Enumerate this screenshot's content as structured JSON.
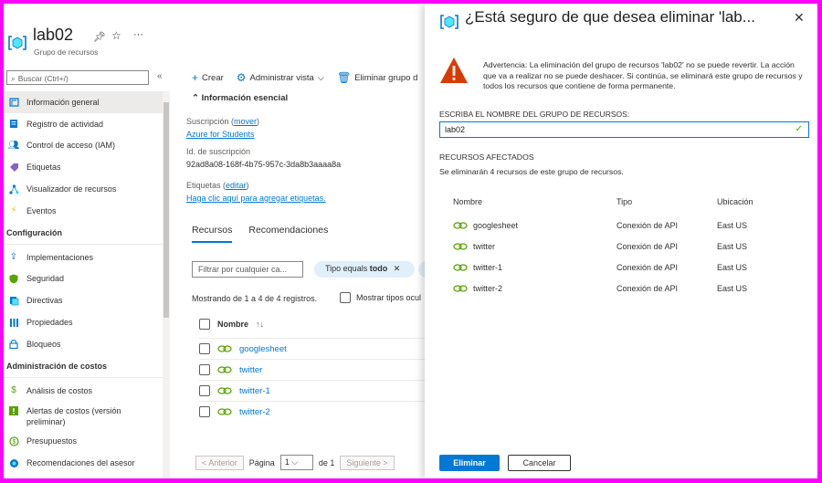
{
  "header": {
    "title": "lab02",
    "subtitle": "Grupo de recursos",
    "more": "···"
  },
  "sidebar": {
    "search_placeholder": "Buscar (Ctrl+/)",
    "collapse": "«",
    "items": [
      {
        "label": "Información general",
        "icon": "overview-icon",
        "active": true
      },
      {
        "label": "Registro de actividad",
        "icon": "activity-log-icon"
      },
      {
        "label": "Control de acceso (IAM)",
        "icon": "iam-icon"
      },
      {
        "label": "Etiquetas",
        "icon": "tag-icon"
      },
      {
        "label": "Visualizador de recursos",
        "icon": "resource-visualizer-icon"
      },
      {
        "label": "Eventos",
        "icon": "events-icon"
      }
    ],
    "section_config": "Configuración",
    "config_items": [
      {
        "label": "Implementaciones",
        "icon": "deployments-icon"
      },
      {
        "label": "Seguridad",
        "icon": "security-icon"
      },
      {
        "label": "Directivas",
        "icon": "policies-icon"
      },
      {
        "label": "Propiedades",
        "icon": "properties-icon"
      },
      {
        "label": "Bloqueos",
        "icon": "lock-icon"
      }
    ],
    "section_cost": "Administración de costos",
    "cost_items": [
      {
        "label": "Análisis de costos",
        "icon": "cost-analysis-icon"
      },
      {
        "label": "Alertas de costos (versión preliminar)",
        "icon": "cost-alerts-icon"
      },
      {
        "label": "Presupuestos",
        "icon": "budgets-icon"
      },
      {
        "label": "Recomendaciones del asesor",
        "icon": "advisor-icon"
      }
    ]
  },
  "commands": {
    "create": "Crear",
    "manage_view": "Administrar vista",
    "delete": "Eliminar grupo d"
  },
  "essentials": {
    "heading": "Información esencial",
    "subscription_label": "Suscripción",
    "subscription_move": "mover",
    "subscription_value": "Azure for Students",
    "subscription_id_label": "Id. de suscripción",
    "subscription_id_value": "92ad8a08-168f-4b75-957c-3da8b3aaaa8a",
    "tags_label": "Etiquetas",
    "tags_edit": "editar",
    "tags_add": "Haga clic aquí para agregar etiquetas."
  },
  "tabs": [
    "Recursos",
    "Recomendaciones"
  ],
  "filter": {
    "placeholder": "Filtrar por cualquier ca...",
    "pill_prefix": "Tipo equals",
    "pill_value": "todo"
  },
  "list": {
    "showing": "Mostrando de 1 a 4 de 4 registros.",
    "show_types": "Mostrar tipos ocul",
    "column_name": "Nombre",
    "sort_icon": "↑↓",
    "rows": [
      "googlesheet",
      "twitter",
      "twitter-1",
      "twitter-2"
    ]
  },
  "pager": {
    "prev": "< Anterior",
    "page_label": "Página",
    "page_value": "1",
    "of": "de 1",
    "next": "Siguiente >"
  },
  "dialog": {
    "title": "¿Está seguro de que desea eliminar 'lab...",
    "close": "✕",
    "warning": "Advertencia: La eliminación del grupo de recursos 'lab02' no se puede revertir. La acción que va a realizar no se puede deshacer. Si continúa, se eliminará este grupo de recursos y todos los recursos que contiene de forma permanente.",
    "input_label": "ESCRIBA EL NOMBRE DEL GRUPO DE RECURSOS:",
    "input_value": "lab02",
    "affected_title": "RECURSOS AFECTADOS",
    "affected_desc": "Se eliminarán 4 recursos de este grupo de recursos.",
    "columns": {
      "name": "Nombre",
      "type": "Tipo",
      "location": "Ubicación"
    },
    "rows": [
      {
        "name": "googlesheet",
        "type": "Conexión de API",
        "location": "East US"
      },
      {
        "name": "twitter",
        "type": "Conexión de API",
        "location": "East US"
      },
      {
        "name": "twitter-1",
        "type": "Conexión de API",
        "location": "East US"
      },
      {
        "name": "twitter-2",
        "type": "Conexión de API",
        "location": "East US"
      }
    ],
    "delete_button": "Eliminar",
    "cancel_button": "Cancelar"
  },
  "colors": {
    "accent": "#0078d4",
    "warning": "#d83b01",
    "frame": "#ff00ff"
  }
}
